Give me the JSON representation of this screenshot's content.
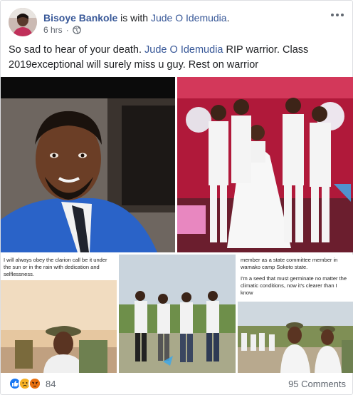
{
  "post": {
    "author": "Bisoye Bankole",
    "with_text": "is with",
    "tagged_name": "Jude O Idemudia",
    "time": "6 hrs",
    "privacy_icon": "globe-icon",
    "body_part1": "So sad to hear of your death.",
    "body_mention": "Jude O Idemudia",
    "body_part2": "RIP warrior. Class 2019exceptional will surely miss u guy. Rest on warrior"
  },
  "photos": {
    "photo3_caption": "I will always obey the clarion call be it under the sun or in the rain with dedication and selflessness.",
    "photo5_caption_1": "member as a state committee member in wamako camp Sokoto state.",
    "photo5_caption_2": "I'm a seed that must germinate no matter the climatic conditions, now it's clearer than I know"
  },
  "footer": {
    "reaction_count": "84",
    "comments": "95 Comments",
    "reaction_icons": [
      "like-icon",
      "sad-icon",
      "angry-icon"
    ]
  },
  "colors": {
    "link": "#385898",
    "like": "#1877f2",
    "sad": "#f7b125",
    "angry": "#e9710f"
  }
}
